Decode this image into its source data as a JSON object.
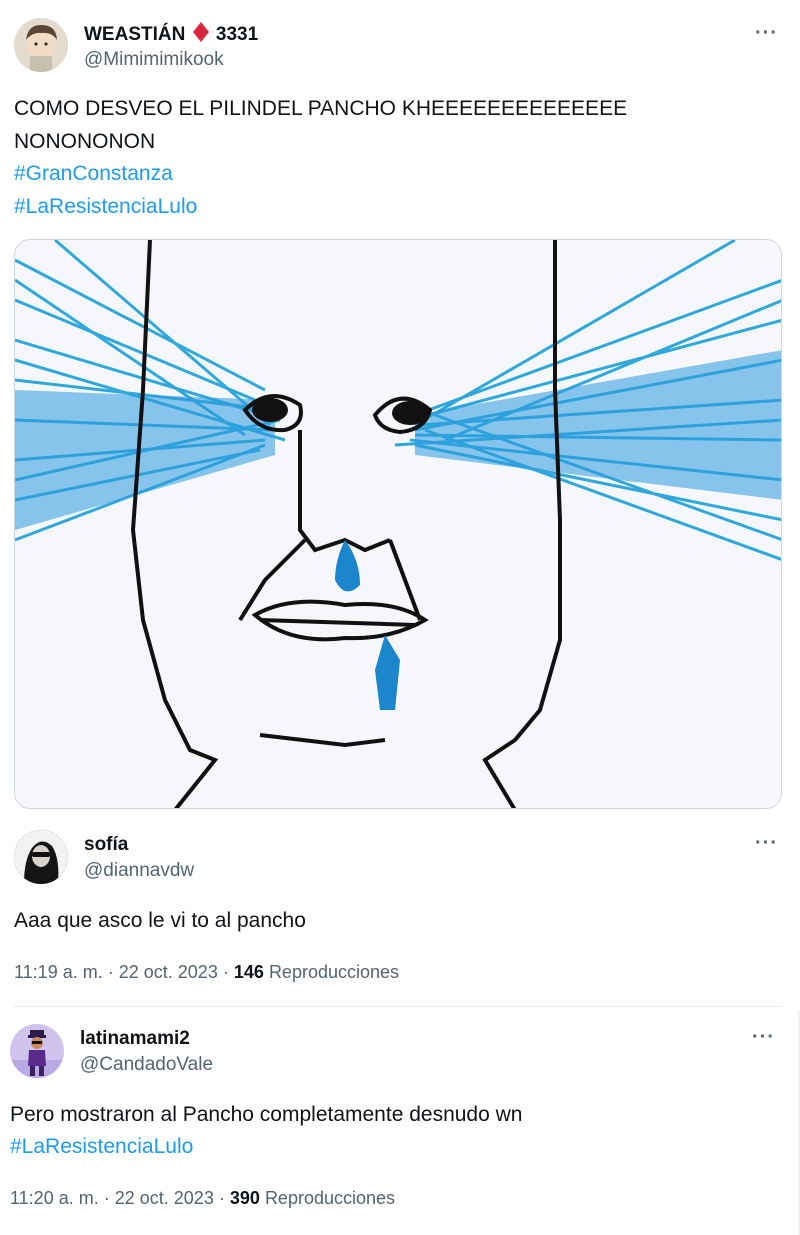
{
  "post1": {
    "display_name": "WEASTIÁN",
    "name_suffix": "3331",
    "handle": "@Mimimimikook",
    "text": "COMO DESVEO EL PILINDEL PANCHO KHEEEEEEEEEEEEEE NONONONON",
    "hashtags": [
      "#GranConstanza",
      "#LaResistenciaLulo"
    ],
    "media_icon": "crying-face-drawing",
    "more_label": "···",
    "accent": "#1d9bf0"
  },
  "reply1": {
    "display_name": "sofía",
    "handle": "@diannavdw",
    "text": "Aaa que asco le vi to al pancho",
    "time": "11:19 a. m.",
    "separator": "·",
    "date": "22 oct. 2023",
    "views": "146",
    "views_label": "Reproducciones",
    "more_label": "···"
  },
  "reply2": {
    "display_name": "latinamami2",
    "handle": "@CandadoVale",
    "text": "Pero mostraron al Pancho completamente desnudo wn",
    "hashtag": "#LaResistenciaLulo",
    "time": "11:20 a. m.",
    "separator": "·",
    "date": "22 oct. 2023",
    "views": "390",
    "views_label": "Reproducciones",
    "more_label": "···"
  }
}
